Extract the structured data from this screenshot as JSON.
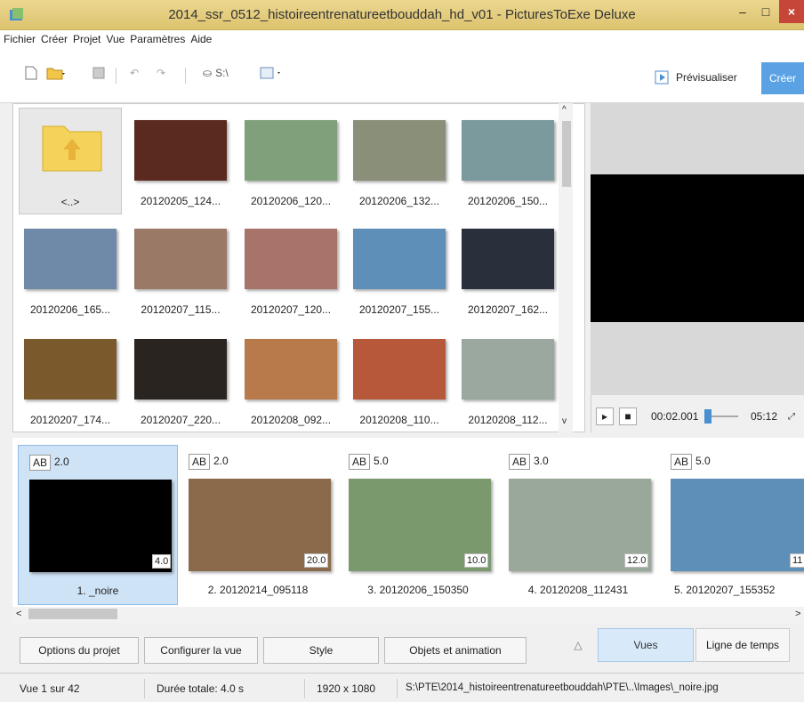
{
  "window": {
    "title": "2014_ssr_0512_histoireentrenatureetbouddah_hd_v01 - PicturesToExe Deluxe",
    "min": "–",
    "max": "□",
    "close": "×"
  },
  "menu": [
    "Fichier",
    "Créer",
    "Projet",
    "Vue",
    "Paramètres",
    "Aide"
  ],
  "toolbar": {
    "path_label": "S:\\",
    "preview_label": "Prévisualiser",
    "create_label": "Créer"
  },
  "files": [
    {
      "label": "<..>",
      "folder": true
    },
    {
      "label": "20120205_124...",
      "color": "#5a2a1e"
    },
    {
      "label": "20120206_120...",
      "color": "#7fa07a"
    },
    {
      "label": "20120206_132...",
      "color": "#8a8f7a"
    },
    {
      "label": "20120206_150...",
      "color": "#7a9a9e"
    },
    {
      "label": "20120206_165...",
      "color": "#6f8aa8"
    },
    {
      "label": "20120207_115...",
      "color": "#9a7a66"
    },
    {
      "label": "20120207_120...",
      "color": "#a8746a"
    },
    {
      "label": "20120207_155...",
      "color": "#5d8fb8"
    },
    {
      "label": "20120207_162...",
      "color": "#2a2f3c"
    },
    {
      "label": "20120207_174...",
      "color": "#7a5a2c"
    },
    {
      "label": "20120207_220...",
      "color": "#2a2420"
    },
    {
      "label": "20120208_092...",
      "color": "#b87a4a"
    },
    {
      "label": "20120208_110...",
      "color": "#b8583a"
    },
    {
      "label": "20120208_112...",
      "color": "#9aa8a0"
    }
  ],
  "player": {
    "time_current": "00:02.001",
    "time_total": "05:12"
  },
  "slides": [
    {
      "ab": "AB",
      "ab_value": "2.0",
      "duration": "4.0",
      "label": "1. _noire",
      "color": "#000000",
      "selected": true
    },
    {
      "ab": "AB",
      "ab_value": "2.0",
      "duration": "20.0",
      "label": "2. 20120214_095118",
      "color": "#8a6a4a"
    },
    {
      "ab": "AB",
      "ab_value": "5.0",
      "duration": "10.0",
      "label": "3. 20120206_150350",
      "color": "#7a9a6e"
    },
    {
      "ab": "AB",
      "ab_value": "3.0",
      "duration": "12.0",
      "label": "4. 20120208_112431",
      "color": "#9aa89a"
    },
    {
      "ab": "AB",
      "ab_value": "5.0",
      "duration": "11",
      "label": "5. 20120207_155352",
      "color": "#5d8fb8"
    }
  ],
  "bottom": {
    "options": "Options du projet",
    "configure": "Configurer la vue",
    "style": "Style",
    "objects": "Objets et animation",
    "collapse": "△",
    "tab_views": "Vues",
    "tab_timeline": "Ligne de temps"
  },
  "status": {
    "slide": "Vue 1 sur 42",
    "duration": "Durée totale: 4.0 s",
    "resolution": "1920 x 1080",
    "path": "S:\\PTE\\2014_histoireentrenatureetbouddah\\PTE\\..\\Images\\_noire.jpg"
  }
}
